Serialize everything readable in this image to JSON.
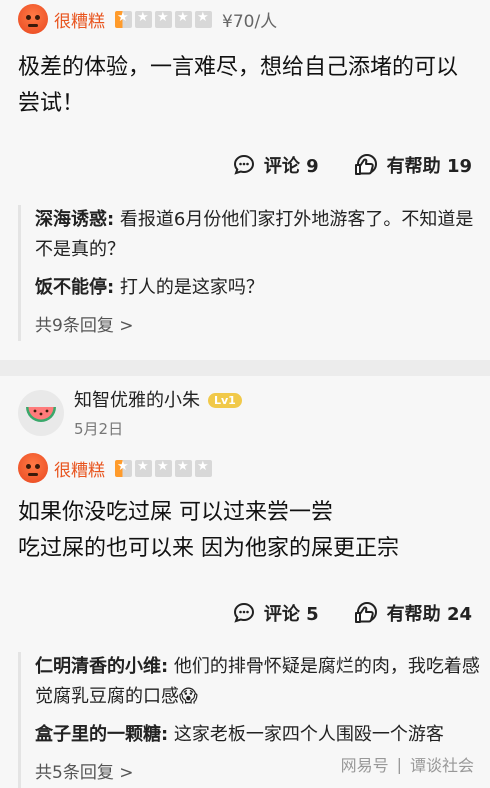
{
  "review1": {
    "rating_label": "很糟糕",
    "price": "¥70/人",
    "text_line1": "极差的体验，一言难尽，想给自己添堵的可以",
    "text_line2": "尝试！",
    "comment_label": "评论 9",
    "helpful_label": "有帮助 19",
    "replies": [
      {
        "author": "深海诱惑:",
        "text": " 看报道6月份他们家打外地游客了。不知道是不是真的？"
      },
      {
        "author": "饭不能停:",
        "text": " 打人的是这家吗？"
      }
    ],
    "more_replies": "共9条回复 >"
  },
  "review2": {
    "username": "知智优雅的小朱",
    "level": "Lv1",
    "date": "5月2日",
    "rating_label": "很糟糕",
    "text_line1": "如果你没吃过屎 可以过来尝一尝",
    "text_line2": "吃过屎的也可以来 因为他家的屎更正宗",
    "comment_label": "评论 5",
    "helpful_label": "有帮助 24",
    "replies": [
      {
        "author": "仁明清香的小维:",
        "text": " 他们的排骨怀疑是腐烂的肉，我吃着感觉腐乳豆腐的口感😱"
      },
      {
        "author": "盒子里的一颗糖:",
        "text": " 这家老板一家四个人围殴一个游客"
      }
    ],
    "more_replies": "共5条回复 >"
  },
  "watermark": {
    "left": "网易号",
    "right": "谭谈社会"
  },
  "icons": {
    "angry": "angry-face-icon",
    "comment": "comment-icon",
    "helpful": "thumbs-up-icon",
    "avatar": "watermelon-avatar-icon"
  }
}
